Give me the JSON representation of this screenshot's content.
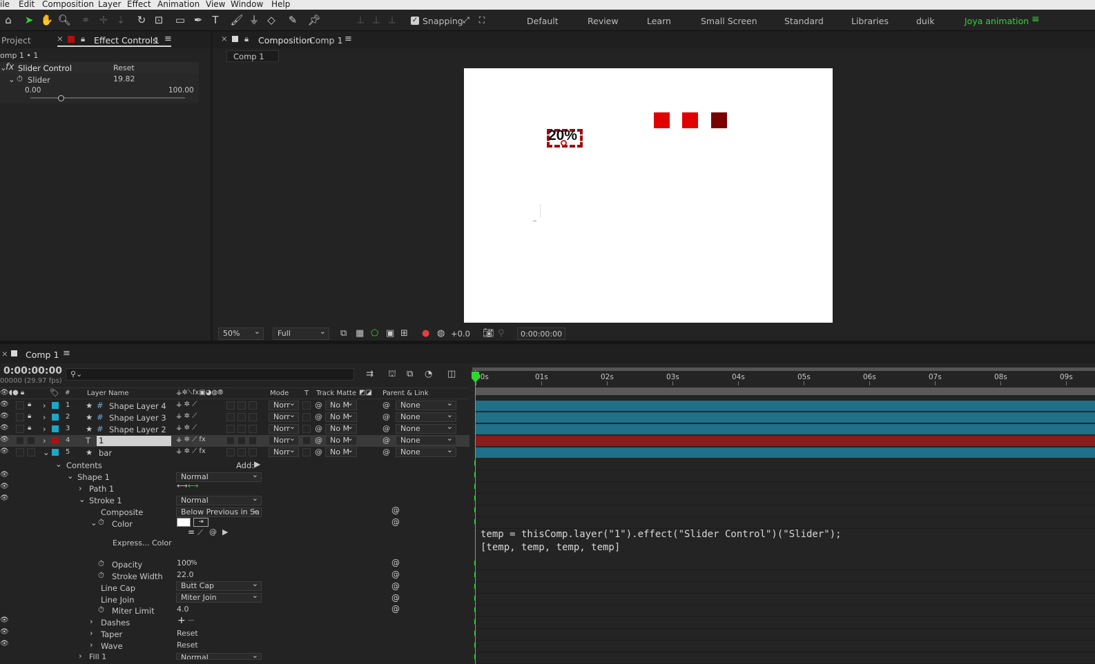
{
  "menu": [
    "ile",
    "Edit",
    "Composition",
    "Layer",
    "Effect",
    "Animation",
    "View",
    "Window",
    "Help"
  ],
  "toolbar": {
    "snapping_label": "Snapping",
    "workspaces": [
      "Default",
      "Review",
      "Learn",
      "Small Screen",
      "Standard",
      "Libraries",
      "duik"
    ],
    "active_workspace": "Joya animation"
  },
  "left_panel": {
    "tab_project": "Project",
    "tab_effect": "Effect Controls",
    "tab_effect_num": "1",
    "comp_path": "omp 1 • 1",
    "effect_name": "Slider Control",
    "reset_label": "Reset",
    "slider_label": "Slider",
    "slider_value": "19.82",
    "slider_min": "0.00",
    "slider_max": "100.00",
    "slider_fraction": 0.1982
  },
  "viewer": {
    "tab_label": "Composition",
    "comp_name": "Comp 1",
    "comp_tab": "Comp 1",
    "overlay_text": "20%",
    "zoom": "50%",
    "resolution": "Full",
    "exposure": "+0.0",
    "timecode": "0:00:00:00",
    "square_colors": [
      "#e00000",
      "#e00000",
      "#7a0000"
    ]
  },
  "timeline": {
    "tab_label": "Comp 1",
    "timecode": "0:00:00:00",
    "fps": "00000 (29.97 fps)",
    "col_layer_name": "Layer Name",
    "col_mode": "Mode",
    "col_t": "T",
    "col_track_matte": "Track Matte",
    "col_parent": "Parent & Link",
    "ruler": [
      "00s",
      "01s",
      "02s",
      "03s",
      "04s",
      "05s",
      "06s",
      "07s",
      "08s",
      "09s"
    ],
    "layers": [
      {
        "num": "1",
        "name": "Shape Layer 4",
        "mode": "Norr",
        "matte": "No M",
        "parent": "None",
        "color": "#1aa8c8"
      },
      {
        "num": "2",
        "name": "Shape Layer 3",
        "mode": "Norr",
        "matte": "No M",
        "parent": "None",
        "color": "#1aa8c8"
      },
      {
        "num": "3",
        "name": "Shape Layer 2",
        "mode": "Norr",
        "matte": "No M",
        "parent": "None",
        "color": "#1aa8c8"
      },
      {
        "num": "4",
        "name": "1",
        "mode": "Norr",
        "matte": "No M",
        "parent": "None",
        "color": "#b01010"
      },
      {
        "num": "5",
        "name": "bar",
        "mode": "Norr",
        "matte": "No M",
        "parent": "None",
        "color": "#1aa8c8"
      }
    ],
    "props": {
      "contents": "Contents",
      "add": "Add:",
      "shape1": "Shape 1",
      "normal": "Normal",
      "path1": "Path 1",
      "stroke1": "Stroke 1",
      "composite": "Composite",
      "composite_val": "Below Previous in Sa",
      "color": "Color",
      "express_color": "Express... Color",
      "opacity": "Opacity",
      "opacity_val": "100",
      "opacity_unit": "%",
      "stroke_width": "Stroke Width",
      "stroke_width_val": "22.0",
      "line_cap": "Line Cap",
      "line_cap_val": "Butt Cap",
      "line_join": "Line Join",
      "line_join_val": "Miter Join",
      "miter_limit": "Miter Limit",
      "miter_limit_val": "4.0",
      "dashes": "Dashes",
      "taper": "Taper",
      "wave": "Wave",
      "reset": "Reset",
      "fill1": "Fill 1"
    },
    "expression_line1": "temp = thisComp.layer(\"1\").effect(\"Slider Control\")(\"Slider\");",
    "expression_line2": "[temp, temp, temp, temp]"
  }
}
